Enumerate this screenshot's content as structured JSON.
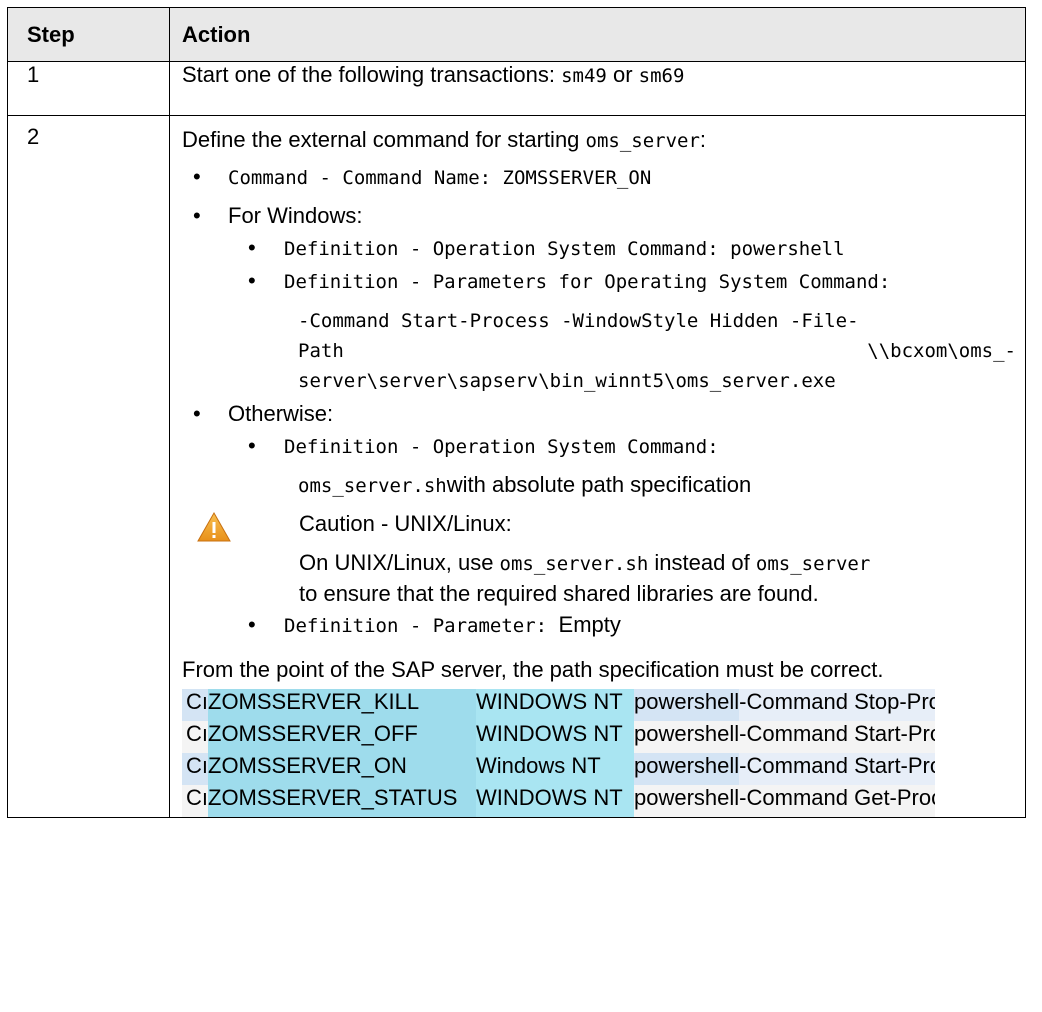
{
  "header": {
    "step": "Step",
    "action": "Action"
  },
  "step1": {
    "num": "1",
    "text": "Start one of the following transactions: ",
    "t1": "sm49",
    "or": " or ",
    "t2": "sm69"
  },
  "step2": {
    "num": "2",
    "intro_text": "Define the external command for starting ",
    "intro_code": "oms_server",
    "intro_colon": ":",
    "cmd_name_label": "Command - Command  Name: ",
    "cmd_name_value": "ZOMSSERVER_ON",
    "windows_label": "For Windows:",
    "win_b1_label": "Definition - Operation System Command: ",
    "win_b1_value": "powershell",
    "win_b2_label": "Definition - Parameters for Operating System Command:",
    "win_param_line1": "-Command Start-Process -WindowStyle Hidden -File-",
    "win_param_line2a": "Path",
    "win_param_line2b": "\\\\bcxom\\oms_-",
    "win_param_line3": "server\\server\\sapserv\\bin_winnt5\\oms_server.exe",
    "otherwise_label": "Otherwise:",
    "oth_b1_label": "Definition - Operation System Command:",
    "oth_value_code": "oms_server.sh",
    "oth_value_text": "with absolute path specification",
    "caution_title": "Caution - UNIX/Linux:",
    "caution_text_1": "On UNIX/Linux, use ",
    "caution_code_1": "oms_server.sh",
    "caution_text_2": " instead of ",
    "caution_code_2": "oms_server",
    "caution_text_3": "to ensure that the required shared libraries are found.",
    "oth_b2_label": "Definition - Parameter: ",
    "oth_b2_value": "Empty",
    "footer_text": "From the point of the SAP server, the path specification must be correct."
  },
  "sap_rows": [
    {
      "type": "Cı",
      "name": "ZOMSSERVER_KILL",
      "os": "WINDOWS NT",
      "cmd": "powershell",
      "params": "-Command Stop-Proces"
    },
    {
      "type": "Cı",
      "name": "ZOMSSERVER_OFF",
      "os": "WINDOWS NT",
      "cmd": "powershell",
      "params": "-Command Start-Proce"
    },
    {
      "type": "Cı",
      "name": "ZOMSSERVER_ON",
      "os": "Windows NT",
      "cmd": "powershell",
      "params": "-Command Start-Proce"
    },
    {
      "type": "Cı",
      "name": "ZOMSSERVER_STATUS",
      "os": "WINDOWS NT",
      "cmd": "powershell",
      "params": "-Command Get-Process"
    }
  ],
  "icons": {
    "caution": "warning-triangle-icon"
  },
  "colors": {
    "header_bg": "#e8e8e8",
    "name_cell": "#9edcec",
    "warn": "#f0a020"
  }
}
